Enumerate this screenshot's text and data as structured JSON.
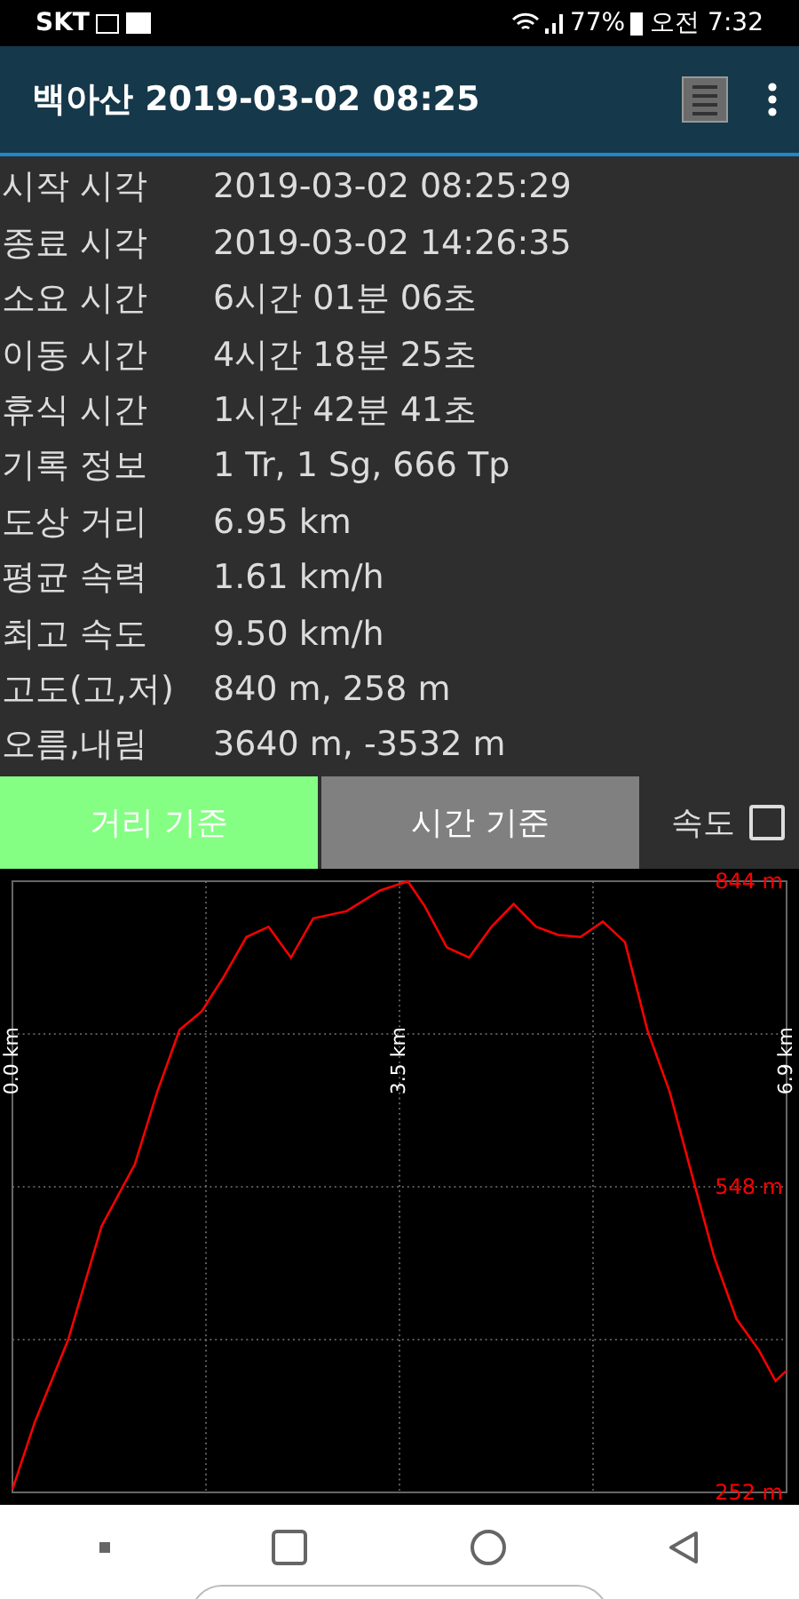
{
  "status_bar": {
    "carrier": "SKT",
    "battery": "77%",
    "time": "오전 7:32"
  },
  "app_bar": {
    "title": "백아산 2019-03-02 08:25"
  },
  "stats": [
    {
      "label": "시작 시각",
      "value": "2019-03-02 08:25:29"
    },
    {
      "label": "종료 시각",
      "value": "2019-03-02 14:26:35"
    },
    {
      "label": "소요 시간",
      "value": "6시간 01분 06초"
    },
    {
      "label": "이동 시간",
      "value": "4시간 18분 25초"
    },
    {
      "label": "휴식 시간",
      "value": "1시간 42분 41초"
    },
    {
      "label": "기록 정보",
      "value": "1 Tr, 1 Sg, 666 Tp"
    },
    {
      "label": "도상 거리",
      "value": "6.95 km"
    },
    {
      "label": "평균 속력",
      "value": "1.61 km/h"
    },
    {
      "label": "최고 속도",
      "value": "9.50 km/h"
    },
    {
      "label": "고도(고,저)",
      "value": "840 m, 258 m"
    },
    {
      "label": "오름,내림",
      "value": "3640 m, -3532 m"
    }
  ],
  "modes": [
    {
      "label": "거리 기준",
      "selected": true
    },
    {
      "label": "시간 기준",
      "selected": false
    }
  ],
  "speed_toggle": {
    "label": "속도",
    "checked": false
  },
  "chart": {
    "chart_data": {
      "type": "line",
      "xlim": [
        0,
        6.95
      ],
      "ylim": [
        252,
        844
      ],
      "xticks": [
        {
          "value": 0,
          "label": "0.0 km"
        },
        {
          "value": 3.475,
          "label": "3.5 km"
        },
        {
          "value": 6.95,
          "label": "6.9 km"
        }
      ],
      "yticks": [
        {
          "value": 844,
          "label": "844 m"
        },
        {
          "value": 548,
          "label": "548 m"
        },
        {
          "value": 252,
          "label": "252 m"
        }
      ],
      "x": [
        0,
        0.2,
        0.5,
        0.8,
        1.1,
        1.3,
        1.5,
        1.7,
        1.9,
        2.1,
        2.3,
        2.5,
        2.7,
        3.0,
        3.3,
        3.55,
        3.7,
        3.9,
        4.1,
        4.3,
        4.5,
        4.7,
        4.9,
        5.1,
        5.3,
        5.5,
        5.7,
        5.9,
        6.1,
        6.3,
        6.5,
        6.7,
        6.85,
        6.95
      ],
      "series": [
        {
          "color": "#ff0000",
          "values": [
            255,
            320,
            400,
            510,
            570,
            640,
            700,
            718,
            752,
            790,
            800,
            770,
            808,
            815,
            835,
            844,
            820,
            780,
            770,
            800,
            822,
            800,
            792,
            790,
            805,
            785,
            700,
            640,
            560,
            480,
            420,
            390,
            360,
            370
          ]
        }
      ]
    }
  }
}
